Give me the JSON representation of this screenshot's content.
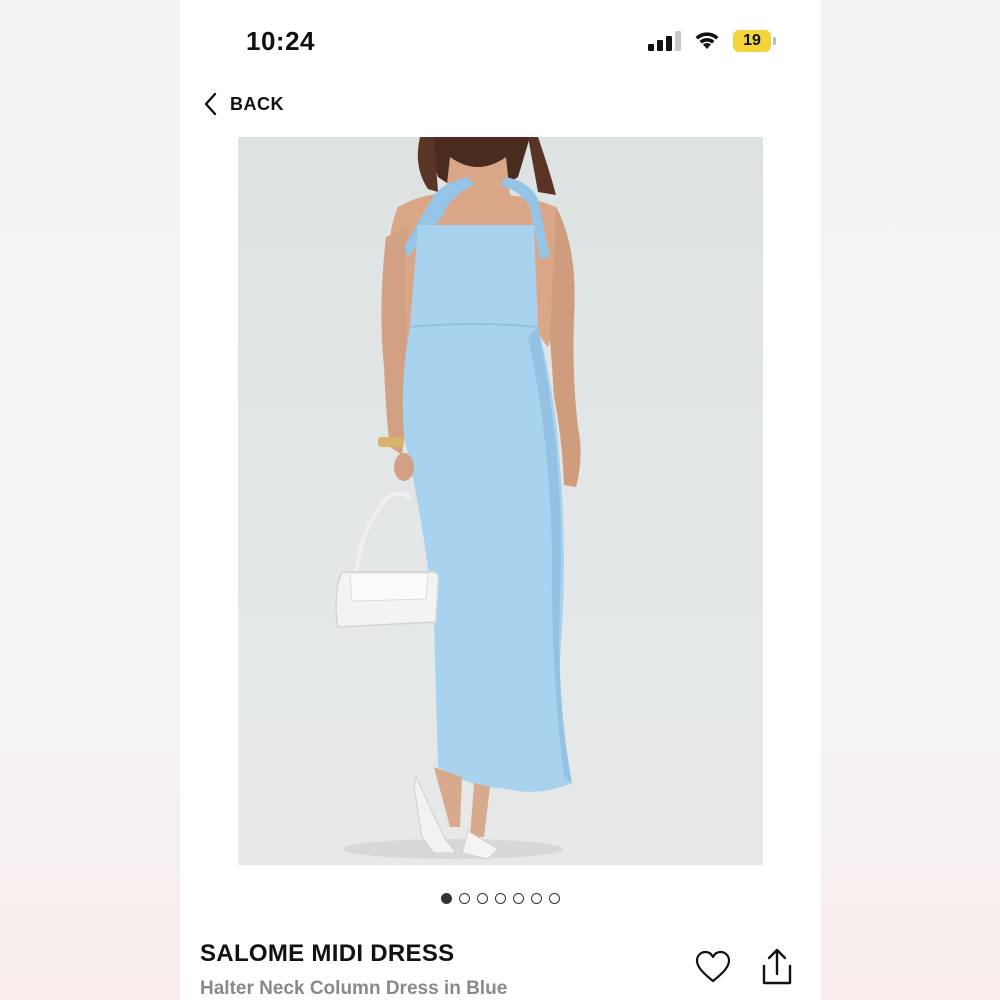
{
  "status_bar": {
    "time": "10:24",
    "battery": "19",
    "battery_color": "#f3d43a",
    "icons": [
      "signal-icon",
      "wifi-icon",
      "battery-icon"
    ]
  },
  "nav": {
    "back_label": "BACK",
    "back_icon": "chevron-left-icon"
  },
  "product": {
    "image_alt": "Model wearing light blue halter neck column dress holding white handbag",
    "dress_color": "#a9d2ef",
    "title": "SALOME MIDI DRESS",
    "subtitle": "Halter Neck Column Dress in Blue",
    "actions": {
      "favorite_icon": "heart-icon",
      "share_icon": "share-icon"
    }
  },
  "carousel": {
    "total": 7,
    "active_index": 0
  }
}
